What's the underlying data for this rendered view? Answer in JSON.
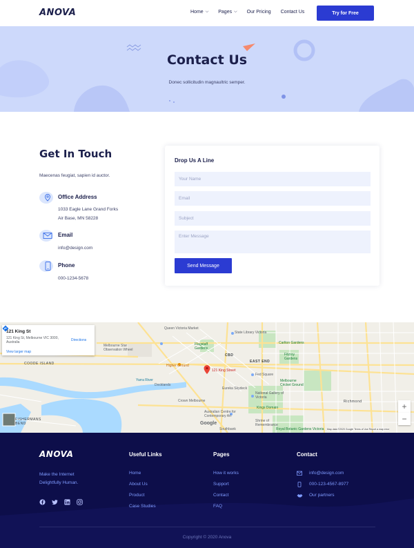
{
  "nav": {
    "logo": "ANOVA",
    "links": [
      {
        "label": "Home",
        "has_caret": true
      },
      {
        "label": "Pages",
        "has_caret": true
      },
      {
        "label": "Our Pricing",
        "has_caret": false
      },
      {
        "label": "Contact Us",
        "has_caret": false
      }
    ],
    "cta": "Try for Free"
  },
  "hero": {
    "title": "Contact Us",
    "subtitle": "Donec sollicitudin magnaultric semper."
  },
  "contact": {
    "title": "Get In Touch",
    "subtitle": "Maecenas feugiat, sapien id auctor.",
    "office": {
      "title": "Office Address",
      "line1": "1033 Eagle Lane Grand Forks",
      "line2": "Air Base, MN 58228",
      "icon": "location-pin-icon"
    },
    "email": {
      "title": "Email",
      "line1": "info@design.com",
      "icon": "envelope-icon"
    },
    "phone": {
      "title": "Phone",
      "line1": "000-1234-5678",
      "icon": "phone-icon"
    }
  },
  "form": {
    "title": "Drop Us A Line",
    "name_placeholder": "Your Name",
    "email_placeholder": "Email",
    "subject_placeholder": "Subject",
    "message_placeholder": "Enter Message",
    "name_value": "",
    "email_value": "",
    "subject_value": "",
    "message_value": "",
    "submit": "Send Message"
  },
  "map": {
    "place_title": "121 King St",
    "place_address": "121 King St, Melbourne VIC 3000, Australia",
    "directions": "Directions",
    "larger_map": "View larger map",
    "pin_label": "121 King Street",
    "labels": {
      "queen_vic": "Queen Victoria Market",
      "state_library": "State Library Victoria",
      "carlton_gardens": "Carlton Gardens",
      "flagstaff": "Flagstaff Gardens",
      "melbourne_star": "Melbourne Star Observation Wheel",
      "cbd": "CBD",
      "east_end": "EAST END",
      "fitzroy": "Fitzroy Gardens",
      "higher_ground": "Higher Ground",
      "fed_square": "Fed Square",
      "melbourne_cricket": "Melbourne Cricket Ground",
      "docklands": "Docklands",
      "yarra": "Yarra River",
      "crown": "Crown Melbourne",
      "eureka": "Eureka Skydeck",
      "rmbg": "Royal Botanic Gardens Victoria",
      "kings_domain": "Kings Domain",
      "acca": "Australian Centre for Contemporary Art",
      "shrine": "Shrine of Remembrance",
      "ngv": "National Gallery of Victoria",
      "richmond": "Richmond",
      "southbank": "Southbank",
      "coode": "COODE ISLAND",
      "fishermans": "FISHERMANS BEND"
    },
    "map_footer": "Map data ©2020 Google   Terms of Use   Report a map error",
    "google": "Google",
    "zoom_in": "+",
    "zoom_out": "−"
  },
  "footer": {
    "logo": "ANOVA",
    "tagline": "Make the Internet Delightfully Human.",
    "socials": [
      "facebook-icon",
      "twitter-icon",
      "linkedin-icon",
      "instagram-icon"
    ],
    "useful_links": {
      "title": "Useful Links",
      "items": [
        "Home",
        "About Us",
        "Product",
        "Case Studies"
      ]
    },
    "pages": {
      "title": "Pages",
      "items": [
        "How it works",
        "Support",
        "Contact",
        "FAQ"
      ]
    },
    "contact": {
      "title": "Contact",
      "email": "info@design.com",
      "phone": "000-123-4567-8977",
      "partners": "Our partners"
    },
    "copyright": "Copyright © 2020 Anova"
  },
  "colors": {
    "primary": "#2b3bd2",
    "navy": "#1b1f4b",
    "hero_bg": "#cdd9fb",
    "footer_bg": "#0d0e4a"
  }
}
